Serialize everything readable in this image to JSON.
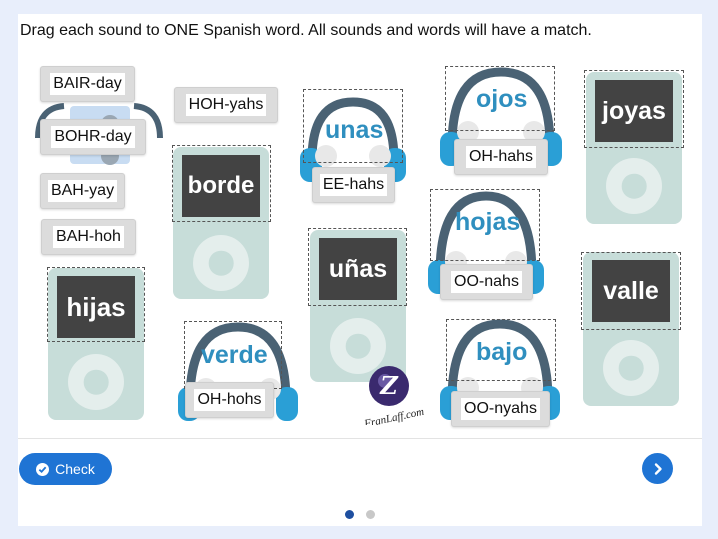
{
  "instruction": "Drag each sound to ONE Spanish word. All sounds and words will have a match.",
  "players": [
    {
      "word": "borde"
    },
    {
      "word": "hijas"
    },
    {
      "word": "uñas"
    },
    {
      "word": "joyas"
    },
    {
      "word": "valle"
    }
  ],
  "headphones": [
    {
      "word": "unas"
    },
    {
      "word": "ojos"
    },
    {
      "word": "hojas"
    },
    {
      "word": "verde"
    },
    {
      "word": "bajo"
    }
  ],
  "chips": [
    {
      "label": "BAIR-day"
    },
    {
      "label": "BOHR-day"
    },
    {
      "label": "BAH-yay"
    },
    {
      "label": "BAH-hoh"
    },
    {
      "label": "HOH-yahs"
    },
    {
      "label": "EE-hahs"
    },
    {
      "label": "OH-hahs"
    },
    {
      "label": "OO-nahs"
    },
    {
      "label": "OH-hohs"
    },
    {
      "label": "OO-nyahs"
    }
  ],
  "logo_text": "FranLaff.com",
  "check_label": "Check",
  "pager": {
    "total": 2,
    "current": 1
  },
  "colors": {
    "accent": "#1f74d4",
    "word_blue": "#2f8fbf",
    "player_body": "#c7ddd9",
    "screen": "#434343",
    "headphone_band": "#4a6274",
    "headphone_cup": "#2a9fd6"
  }
}
